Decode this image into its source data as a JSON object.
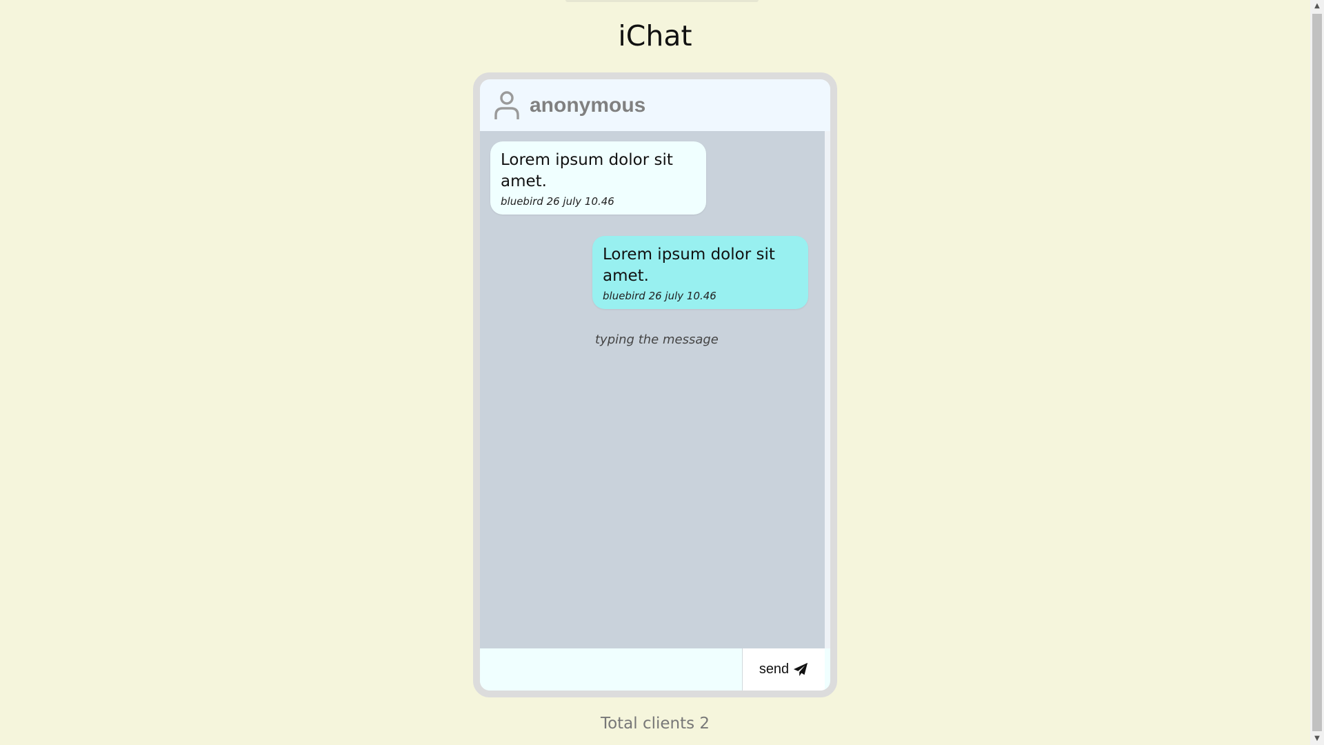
{
  "app": {
    "title": "iChat"
  },
  "chat": {
    "header": {
      "user_name": "anonymous",
      "icon": "user-icon"
    },
    "messages": [
      {
        "text": "Lorem ipsum dolor sit amet.",
        "meta": "bluebird 26 july 10.46",
        "direction": "incoming"
      },
      {
        "text": "Lorem ipsum dolor sit amet.",
        "meta": "bluebird 26 july 10.46",
        "direction": "outgoing"
      }
    ],
    "typing_indicator": "typing the message"
  },
  "composer": {
    "input_value": "",
    "send_label": "send",
    "send_icon": "paper-plane-icon"
  },
  "footer": {
    "total_clients": "Total clients 2"
  },
  "colors": {
    "page_bg": "#f5f5dc",
    "header_bg": "#f0f8ff",
    "messages_bg": "#c9d2db",
    "incoming_bubble": "#f0ffff",
    "outgoing_bubble": "#98f0f0",
    "frame": "#dcdcdc"
  }
}
